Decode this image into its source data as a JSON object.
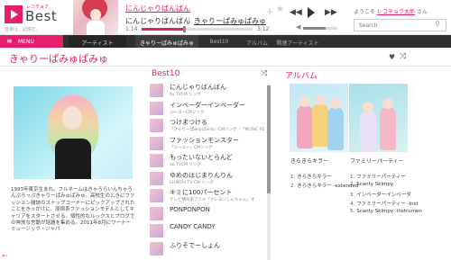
{
  "header": {
    "logo_sub": "レコチョク",
    "logo_title": "Best",
    "tagline": "音楽は、記憶だ。",
    "now_playing": {
      "title": "にんじゃりばんばん",
      "artist": "にんじゃりばんばん",
      "separator": "|",
      "album": "きゃりーぱみゅぱみゅ",
      "current_time": "1:14",
      "duration": "3:12",
      "progress": 0.385,
      "volume": 0.65
    },
    "welcome": "ようこそ",
    "user_name": "レコチョク太郎",
    "welcome_suffix": "さん",
    "search_placeholder": "Search",
    "icons": {
      "add": "＋",
      "favorite": "★",
      "prev": "◀◀",
      "next": "▶▶",
      "volume": "◀",
      "search": "⚲"
    }
  },
  "nav": {
    "menu": "MENU",
    "tabs": [
      "アーティスト",
      "きゃりーぱみゅぱみゅ",
      "Best10",
      "アルバム",
      "関連アーティスト"
    ]
  },
  "artist": {
    "name": "きゃりーぱみゅぱみゅ",
    "bio": "1993年東京生まれ。フルネームはきゃろらいんちゃろんぷろっぷきゃりーぱみゅぱみゅ。高校生のときにファッション雑誌のスナップコーナーにピックアップされたことをきっかけに、原宿系ファッションモデルとしてキャリアをスタートさせる。個性的なルックスとブログでの奔放な言動が話題を集める。2011年8月にワーナーミュージック・ジャパ"
  },
  "best10": {
    "title": "Best10",
    "tracks": [
      {
        "title": "にんじゃりばんばん",
        "meta": "by TVCM ソング"
      },
      {
        "title": "インベーダーインベーダー",
        "meta": "ジーユーCMソング"
      },
      {
        "title": "つけまつける",
        "meta": "「きゃりーぱみゅぱみゅ」CMソング／「MUSIC FOC"
      },
      {
        "title": "ファッションモンスター",
        "meta": "「ジーユー」CMソング"
      },
      {
        "title": "もったいないとらんど",
        "meta": "au TVCM ソング"
      },
      {
        "title": "ゆめのはじまりんりん",
        "meta": "CHINTAI TV-CM ソング"
      },
      {
        "title": "キミに100パーセント",
        "meta": "テレビ朝日系アニメ「クレヨンしんちゃん」オ"
      },
      {
        "title": "PONPONPON",
        "meta": ""
      },
      {
        "title": "CANDY CANDY",
        "meta": ""
      },
      {
        "title": "ふりそでーしょん",
        "meta": ""
      }
    ]
  },
  "albums": {
    "title": "アルバム",
    "items": [
      {
        "name": "きらきらキラー",
        "tracks": [
          {
            "num": "1.",
            "title": "きらきらキラー"
          },
          {
            "num": "2.",
            "title": "きらきらキラー -extended"
          }
        ]
      },
      {
        "name": "ファミリーパーティー",
        "tracks": [
          {
            "num": "1.",
            "title": "ファミリーパーティー"
          },
          {
            "num": "2.",
            "title": "Scanty Skimpy"
          },
          {
            "num": "3.",
            "title": "インベーダーインベーダ"
          },
          {
            "num": "4.",
            "title": "ファミリーパーティー -inst"
          },
          {
            "num": "5.",
            "title": "Scanty Skimpy -instrumen"
          }
        ]
      }
    ]
  },
  "bottom": {
    "arrows": "«‹"
  },
  "colors": {
    "accent": "#e61f6b",
    "navbar": "#2f2f2f"
  }
}
